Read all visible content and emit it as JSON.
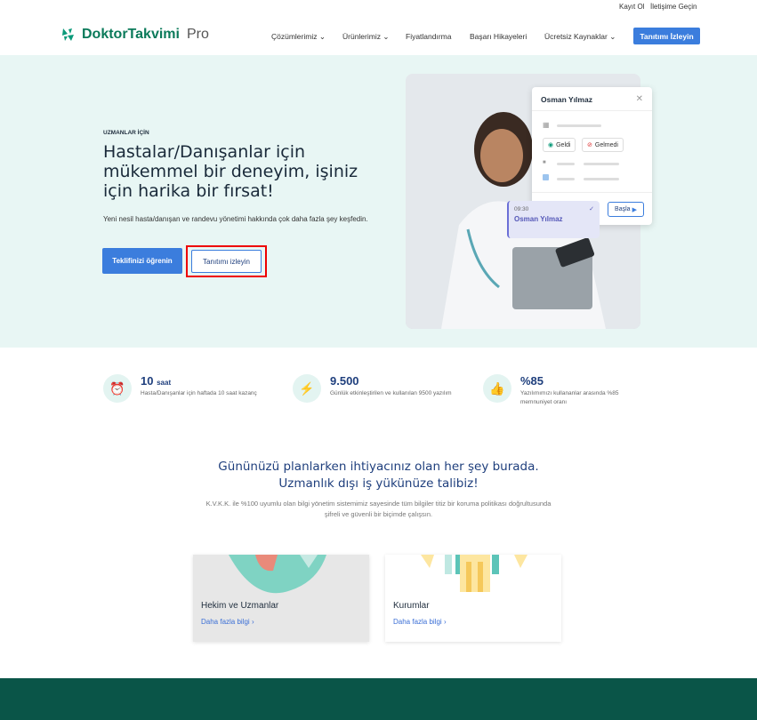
{
  "topbar": {
    "register": "Kayıt Ol",
    "contact": "İletişime Geçin"
  },
  "logo": {
    "brand": "DoktorTakvimi",
    "suffix": "Pro"
  },
  "nav": {
    "solutions": "Çözümlerimiz",
    "products": "Ürünlerimiz",
    "pricing": "Fiyatlandırma",
    "success": "Başarı Hikayeleri",
    "free": "Ücretsiz Kaynaklar",
    "cta": "Tanıtımı İzleyin"
  },
  "hero": {
    "eyebrow": "UZMANLAR İÇİN",
    "headline": "Hastalar/Danışanlar için mükemmel bir deneyim, işiniz için harika bir fırsat!",
    "sub": "Yeni nesil hasta/danışan ve randevu yönetimi hakkında çok daha fazla şey keşfedin.",
    "primary": "Teklifinizi öğrenin",
    "secondary": "Tanıtımı izleyin"
  },
  "card": {
    "name": "Osman Yılmaz",
    "came": "Geldi",
    "notcame": "Gelmedi",
    "time": "09:30",
    "appt_name": "Osman Yılmaz",
    "start": "Başla"
  },
  "stats": [
    {
      "value": "10",
      "unit": "saat",
      "desc": "Hasta/Danışanlar için haftada 10 saat kazanç"
    },
    {
      "value": "9.500",
      "unit": "",
      "desc": "Günlük etkinleştirilen ve kullanılan 9500 yazılım"
    },
    {
      "value": "%85",
      "unit": "",
      "desc": "Yazılımımızı kullananlar arasında %85 memnuniyet oranı"
    }
  ],
  "section": {
    "title": "Gününüzü planlarken ihtiyacınız olan her şey burada. Uzmanlık dışı iş yükünüze talibiz!",
    "sub": "K.V.K.K. ile %100 uyumlu olan bilgi yönetim sistemimiz sayesinde tüm bilgiler titiz bir koruma politikası doğrultusunda şifreli ve güvenli bir biçimde çalışsın."
  },
  "cards": [
    {
      "title": "Hekim ve Uzmanlar",
      "link": "Daha fazla bilgi"
    },
    {
      "title": "Kurumlar",
      "link": "Daha fazla bilgi"
    }
  ],
  "colors": {
    "accent": "#3b7ddd",
    "brand": "#0b7a5a",
    "hero_bg": "#e8f6f4",
    "footer": "#0a5548"
  }
}
